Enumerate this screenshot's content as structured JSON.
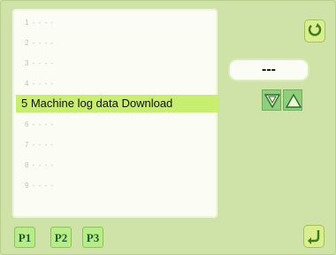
{
  "list": {
    "items": [
      {
        "label": "1 - - - -"
      },
      {
        "label": "2 - - - -"
      },
      {
        "label": "3 - - - -"
      },
      {
        "label": "4 - - - -"
      },
      {
        "label": "5 Machine log data Download"
      },
      {
        "label": "6 - - - -"
      },
      {
        "label": "7 - - - -"
      },
      {
        "label": "8 - - - -"
      },
      {
        "label": "9 - - - -"
      }
    ],
    "selected_index": 4
  },
  "value_display": {
    "text": "---"
  },
  "pages": [
    {
      "label": "P1"
    },
    {
      "label": "P2"
    },
    {
      "label": "P3"
    }
  ],
  "icons": {
    "top_right": "rotate-refresh-icon",
    "bottom_right": "return-enter-icon",
    "down": "down-triangle-icon",
    "up": "up-triangle-icon"
  }
}
